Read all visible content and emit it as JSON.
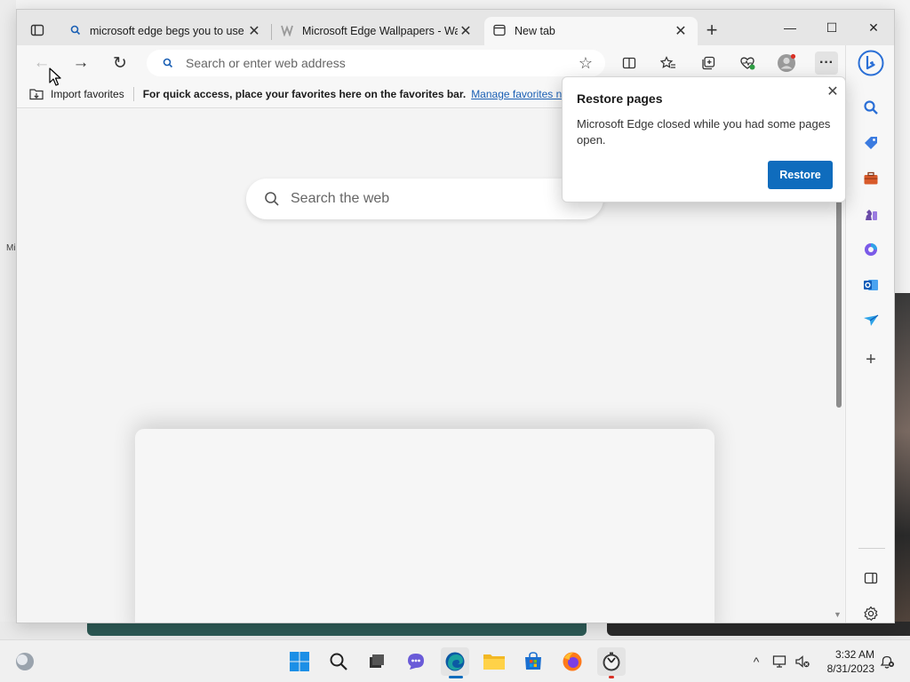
{
  "window": {
    "tabs": [
      {
        "title": "microsoft edge begs you to use",
        "icon": "search-icon",
        "close": "✕"
      },
      {
        "title": "Microsoft Edge Wallpapers - Wal",
        "icon": "wallpaper-site-icon",
        "close": "✕"
      },
      {
        "title": "New tab",
        "icon": "new-tab-page-icon",
        "close": "✕"
      }
    ],
    "new_tab_glyph": "+",
    "controls": {
      "minimize": "—",
      "maximize": "☐",
      "close": "✕"
    }
  },
  "toolbar": {
    "back": "←",
    "forward": "→",
    "refresh": "↻",
    "address_placeholder": "Search or enter web address",
    "favorite_star": "☆",
    "more": "···"
  },
  "favorites_bar": {
    "import_label": "Import favorites",
    "hint": "For quick access, place your favorites here on the favorites bar.",
    "manage_link": "Manage favorites now"
  },
  "new_tab_page": {
    "search_placeholder": "Search the web"
  },
  "restore_popup": {
    "title": "Restore pages",
    "body": "Microsoft Edge closed while you had some pages open.",
    "restore_button": "Restore",
    "close": "✕"
  },
  "sidebar": {
    "add": "+"
  },
  "desktop": {
    "partial_label": "Mi"
  },
  "taskbar": {
    "time": "3:32 AM",
    "date": "8/31/2023",
    "tray_chevron": "^"
  },
  "colors": {
    "accent": "#0f6cbd",
    "link": "#1a5fb4",
    "edge_teal": "#1ba1a1",
    "edge_blue": "#0c59a4"
  }
}
